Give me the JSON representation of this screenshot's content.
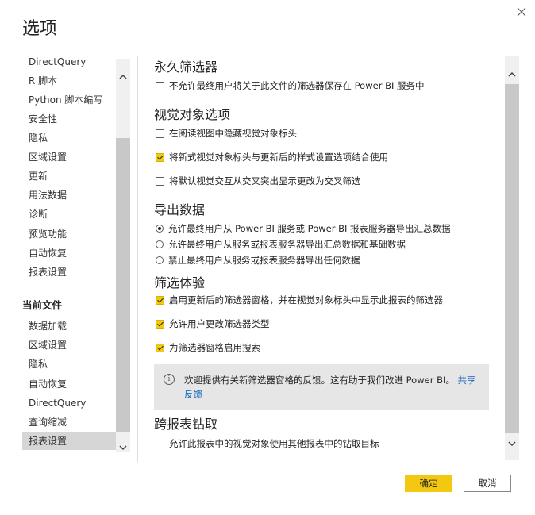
{
  "dialog": {
    "title": "选项",
    "ok_label": "确定",
    "cancel_label": "取消"
  },
  "nav": {
    "global_items": [
      "DirectQuery",
      "R 脚本",
      "Python 脚本编写",
      "安全性",
      "隐私",
      "区域设置",
      "更新",
      "用法数据",
      "诊断",
      "预览功能",
      "自动恢复",
      "报表设置"
    ],
    "current_file_header": "当前文件",
    "file_items": [
      "数据加载",
      "区域设置",
      "隐私",
      "自动恢复",
      "DirectQuery",
      "查询缩减",
      "报表设置"
    ],
    "selected": "报表设置"
  },
  "content": {
    "persistent_filters": {
      "heading": "永久筛选器",
      "opt1": "不允许最终用户将关于此文件的筛选器保存在 Power BI 服务中"
    },
    "visual_options": {
      "heading": "视觉对象选项",
      "opt1": "在阅读视图中隐藏视觉对象标头",
      "opt2": "将新式视觉对象标头与更新后的样式设置选项结合使用",
      "opt3": "将默认视觉交互从交叉突出显示更改为交叉筛选"
    },
    "export_data": {
      "heading": "导出数据",
      "opt1": "允许最终用户从 Power BI 服务或 Power BI 报表服务器导出汇总数据",
      "opt2": "允许最终用户从服务或报表服务器导出汇总数据和基础数据",
      "opt3": "禁止最终用户从服务或报表服务器导出任何数据"
    },
    "filter_experience": {
      "heading": "筛选体验",
      "opt1": "启用更新后的筛选器窗格，并在视觉对象标头中显示此报表的筛选器",
      "opt2": "允许用户更改筛选器类型",
      "opt3": "为筛选器窗格启用搜索"
    },
    "info": {
      "text": "欢迎提供有关新筛选器窗格的反馈。这有助于我们改进 Power BI。",
      "link": "共享反馈"
    },
    "cross_report": {
      "heading": "跨报表钻取",
      "opt1": "允许此报表中的视觉对象使用其他报表中的钻取目标"
    }
  },
  "colors": {
    "accent": "#f2c811",
    "link": "#1a66bd",
    "selected_nav": "#d6d6d6"
  }
}
